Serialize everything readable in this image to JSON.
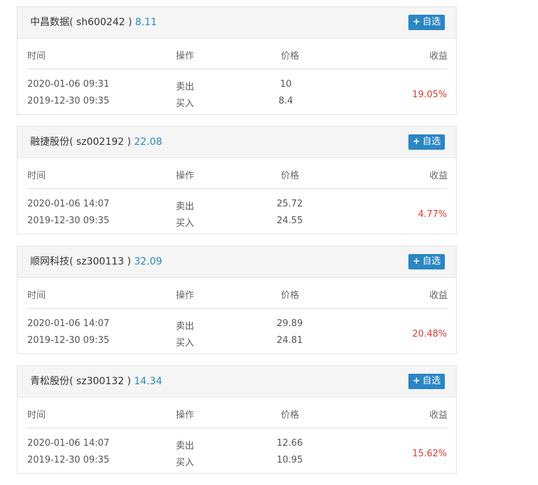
{
  "add_button": {
    "plus": "+",
    "label": "自选"
  },
  "columns": {
    "time": "时间",
    "op": "操作",
    "price": "价格",
    "yield": "收益"
  },
  "cards": [
    {
      "name": "中昌数据",
      "code_open": "( ",
      "code": "sh600242",
      "code_close": " )",
      "price": "8.11",
      "trades": [
        {
          "time": "2020-01-06 09:31",
          "op": "卖出",
          "price": "10"
        },
        {
          "time": "2019-12-30 09:35",
          "op": "买入",
          "price": "8.4"
        }
      ],
      "yield": "19.05%"
    },
    {
      "name": "融捷股份",
      "code_open": "( ",
      "code": "sz002192",
      "code_close": " )",
      "price": "22.08",
      "trades": [
        {
          "time": "2020-01-06 14:07",
          "op": "卖出",
          "price": "25.72"
        },
        {
          "time": "2019-12-30 09:35",
          "op": "买入",
          "price": "24.55"
        }
      ],
      "yield": "4.77%"
    },
    {
      "name": "顺网科技",
      "code_open": "( ",
      "code": "sz300113",
      "code_close": " )",
      "price": "32.09",
      "trades": [
        {
          "time": "2020-01-06 14:07",
          "op": "卖出",
          "price": "29.89"
        },
        {
          "time": "2019-12-30 09:35",
          "op": "买入",
          "price": "24.81"
        }
      ],
      "yield": "20.48%"
    },
    {
      "name": "青松股份",
      "code_open": "( ",
      "code": "sz300132",
      "code_close": " )",
      "price": "14.34",
      "trades": [
        {
          "time": "2020-01-06 14:07",
          "op": "卖出",
          "price": "12.66"
        },
        {
          "time": "2019-12-30 09:35",
          "op": "买入",
          "price": "10.95"
        }
      ],
      "yield": "15.62%"
    }
  ],
  "colors": {
    "accent": "#2b86c5",
    "profit": "#e03c31",
    "header_bg": "#f5f5f5"
  }
}
